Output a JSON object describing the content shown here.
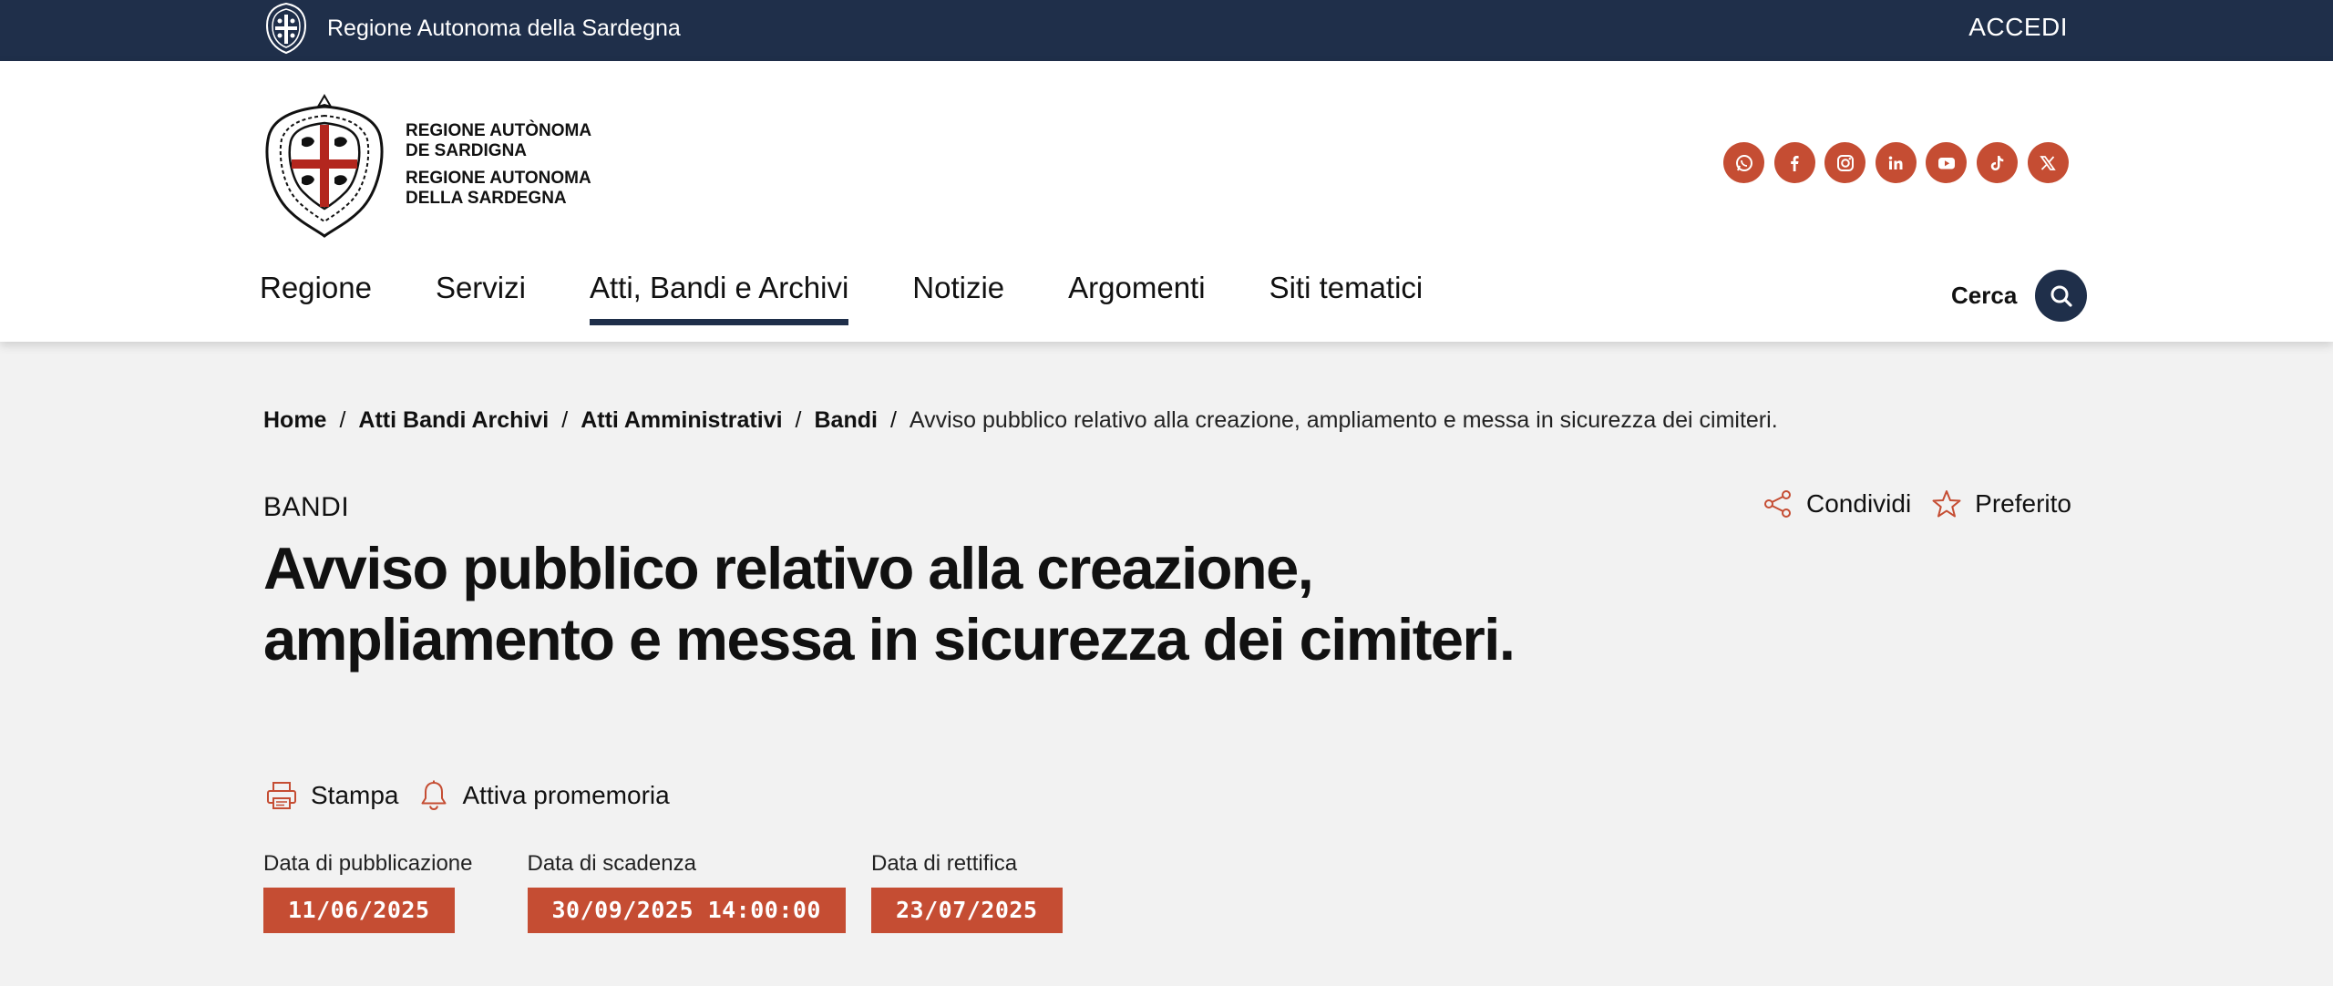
{
  "topbar": {
    "brand": "Regione Autonoma della Sardegna",
    "login": "ACCEDI"
  },
  "header": {
    "logo_lines": [
      "REGIONE AUTÒNOMA",
      "DE SARDIGNA",
      "REGIONE AUTONOMA",
      "DELLA SARDEGNA"
    ],
    "socials": [
      "whatsapp-icon",
      "facebook-icon",
      "instagram-icon",
      "linkedin-icon",
      "youtube-icon",
      "tiktok-icon",
      "x-icon"
    ],
    "nav": [
      "Regione",
      "Servizi",
      "Atti, Bandi e Archivi",
      "Notizie",
      "Argomenti",
      "Siti tematici"
    ],
    "active_nav": "Atti, Bandi e Archivi",
    "search_label": "Cerca"
  },
  "breadcrumb": {
    "items": [
      "Home",
      "Atti Bandi Archivi",
      "Atti Amministrativi",
      "Bandi"
    ],
    "current": "Avviso pubblico relativo alla creazione, ampliamento e messa in sicurezza dei cimiteri."
  },
  "page": {
    "category": "BANDI",
    "title_line1": "Avviso pubblico relativo alla creazione,",
    "title_line2": "ampliamento e messa in sicurezza dei cimiteri.",
    "share_label": "Condividi",
    "favorite_label": "Preferito",
    "print_label": "Stampa",
    "reminder_label": "Attiva promemoria"
  },
  "dates": {
    "publication_label": "Data di pubblicazione",
    "publication_value": "11/06/2025",
    "deadline_label": "Data di scadenza",
    "deadline_value": "30/09/2025 14:00:00",
    "rectification_label": "Data di rettifica",
    "rectification_value": "23/07/2025"
  },
  "colors": {
    "navy": "#1f2f4a",
    "accent": "#c54d33",
    "background": "#f2f2f2"
  }
}
